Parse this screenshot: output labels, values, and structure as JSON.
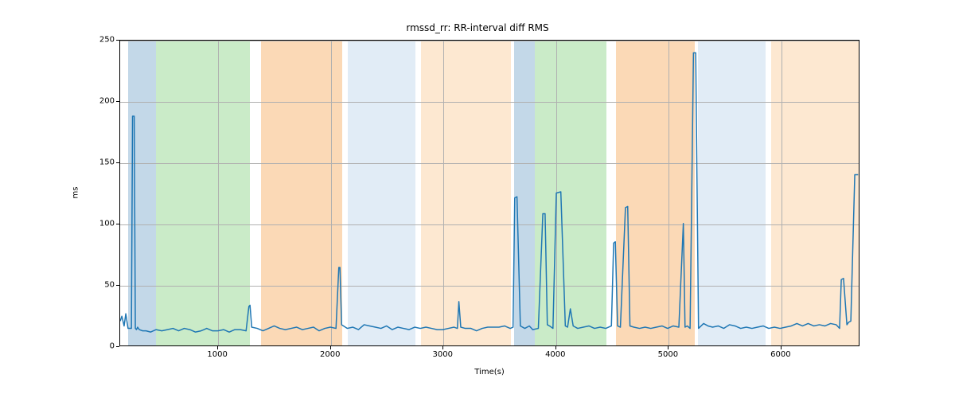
{
  "chart_data": {
    "type": "line",
    "title": "rmssd_rr: RR-interval diff RMS",
    "xlabel": "Time(s)",
    "ylabel": "ms",
    "xlim": [
      130,
      6700
    ],
    "ylim": [
      0,
      250
    ],
    "x_ticks": [
      1000,
      2000,
      3000,
      4000,
      5000,
      6000
    ],
    "y_ticks": [
      0,
      50,
      100,
      150,
      200,
      250
    ],
    "bands": [
      {
        "start": 200,
        "end": 450,
        "color": "#c3d8e8"
      },
      {
        "start": 450,
        "end": 1280,
        "color": "#caebc8"
      },
      {
        "start": 1380,
        "end": 2100,
        "color": "#fbd9b6"
      },
      {
        "start": 2150,
        "end": 2750,
        "color": "#e1ecf6"
      },
      {
        "start": 2800,
        "end": 3600,
        "color": "#fde8d1"
      },
      {
        "start": 3630,
        "end": 3810,
        "color": "#c3d8e8"
      },
      {
        "start": 3810,
        "end": 4450,
        "color": "#caebc8"
      },
      {
        "start": 4530,
        "end": 5230,
        "color": "#fbd9b6"
      },
      {
        "start": 5260,
        "end": 5860,
        "color": "#e1ecf6"
      },
      {
        "start": 5910,
        "end": 6700,
        "color": "#fde8d1"
      }
    ],
    "series": [
      {
        "name": "rmssd_rr",
        "color": "#1f77b4",
        "x": [
          130,
          145,
          165,
          180,
          200,
          210,
          230,
          240,
          255,
          265,
          275,
          285,
          300,
          330,
          360,
          400,
          450,
          500,
          550,
          600,
          650,
          700,
          750,
          800,
          850,
          900,
          950,
          1000,
          1050,
          1100,
          1150,
          1200,
          1250,
          1275,
          1285,
          1300,
          1350,
          1400,
          1450,
          1500,
          1550,
          1600,
          1650,
          1700,
          1750,
          1800,
          1850,
          1900,
          1950,
          2000,
          2050,
          2075,
          2085,
          2100,
          2150,
          2200,
          2250,
          2300,
          2350,
          2400,
          2450,
          2500,
          2550,
          2600,
          2650,
          2700,
          2750,
          2800,
          2850,
          2900,
          2950,
          3000,
          3050,
          3100,
          3130,
          3143,
          3160,
          3200,
          3250,
          3300,
          3350,
          3400,
          3450,
          3500,
          3550,
          3600,
          3625,
          3640,
          3660,
          3690,
          3730,
          3770,
          3800,
          3850,
          3890,
          3910,
          3930,
          3950,
          3980,
          4010,
          4050,
          4090,
          4110,
          4135,
          4160,
          4200,
          4250,
          4300,
          4350,
          4400,
          4450,
          4500,
          4520,
          4535,
          4555,
          4580,
          4625,
          4645,
          4665,
          4700,
          4750,
          4800,
          4850,
          4900,
          4950,
          5000,
          5050,
          5100,
          5140,
          5155,
          5175,
          5200,
          5230,
          5250,
          5275,
          5320,
          5360,
          5400,
          5450,
          5500,
          5550,
          5600,
          5650,
          5700,
          5750,
          5800,
          5850,
          5900,
          5950,
          6000,
          6050,
          6100,
          6150,
          6200,
          6250,
          6300,
          6350,
          6400,
          6450,
          6500,
          6530,
          6545,
          6565,
          6595,
          6610,
          6630,
          6665,
          6695
        ],
        "y": [
          20,
          24,
          16,
          26,
          14,
          14,
          14,
          188,
          188,
          14,
          13,
          15,
          13,
          12,
          12,
          11,
          13,
          12,
          13,
          14,
          12,
          14,
          13,
          11,
          12,
          14,
          12,
          12,
          13,
          11,
          13,
          13,
          12,
          32,
          33,
          15,
          14,
          12,
          14,
          16,
          14,
          13,
          14,
          15,
          13,
          14,
          15,
          12,
          14,
          15,
          14,
          64,
          64,
          17,
          14,
          15,
          13,
          17,
          16,
          15,
          14,
          16,
          13,
          15,
          14,
          13,
          15,
          14,
          15,
          14,
          13,
          13,
          14,
          15,
          14,
          36,
          15,
          14,
          14,
          12,
          14,
          15,
          15,
          15,
          16,
          14,
          15,
          121,
          122,
          16,
          14,
          16,
          13,
          14,
          108,
          108,
          17,
          16,
          14,
          125,
          126,
          16,
          15,
          30,
          16,
          14,
          15,
          16,
          14,
          15,
          14,
          16,
          84,
          85,
          16,
          15,
          113,
          114,
          16,
          15,
          14,
          15,
          14,
          15,
          16,
          14,
          16,
          15,
          100,
          15,
          16,
          14,
          240,
          240,
          14,
          18,
          16,
          15,
          16,
          14,
          17,
          16,
          14,
          15,
          14,
          15,
          16,
          14,
          15,
          14,
          15,
          16,
          18,
          16,
          18,
          16,
          17,
          16,
          18,
          17,
          14,
          54,
          55,
          17,
          19,
          20,
          140,
          140
        ]
      }
    ]
  }
}
